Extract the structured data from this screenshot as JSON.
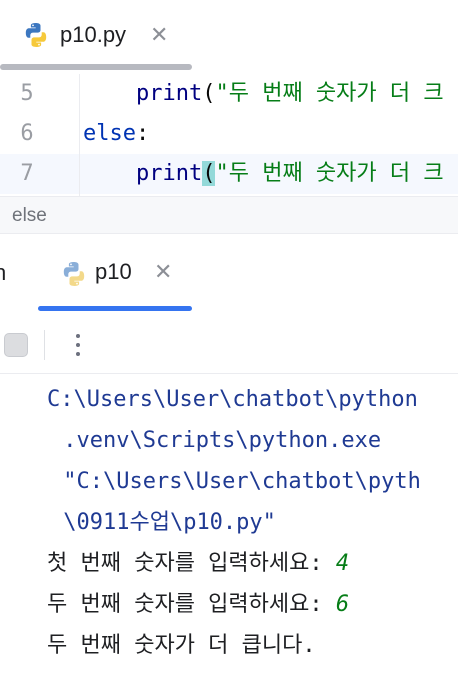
{
  "editor": {
    "tab": {
      "label": "p10.py",
      "close": "✕",
      "icon": "python-icon"
    },
    "lines": [
      {
        "number": "5",
        "indent": "    ",
        "func": "print",
        "paren": "(",
        "string": "\"두 번째 숫자가 더 크",
        "current": false
      },
      {
        "number": "6",
        "keyword": "else",
        "colon": ":",
        "current": false
      },
      {
        "number": "7",
        "indent": "    ",
        "func": "print",
        "paren": "(",
        "string": "\"두 번째 숫자가 더 크",
        "current": true
      }
    ]
  },
  "breadcrumb": {
    "text": "else"
  },
  "run_window": {
    "prev_tab_fragment": "n",
    "tab": {
      "label": "p10",
      "close": "✕",
      "icon": "python-icon"
    },
    "toolbar": {
      "stop": "stop-icon",
      "more": "more-vertical-icon"
    }
  },
  "console": {
    "command_lines": [
      "C:\\Users\\User\\chatbot\\python",
      " .venv\\Scripts\\python.exe",
      " \"C:\\Users\\User\\chatbot\\pyth",
      " \\0911수업\\p10.py\""
    ],
    "prompt1": {
      "text": "첫 번째 숫자를 입력하세요: ",
      "value": "4"
    },
    "prompt2": {
      "text": "두 번째 숫자를 입력하세요: ",
      "value": "6"
    },
    "result": "두 번째 숫자가 더 큽니다."
  },
  "colors": {
    "accent": "#3574f0",
    "keyword": "#0033b3",
    "string": "#067d17",
    "brace_highlight": "#93d9d9"
  }
}
